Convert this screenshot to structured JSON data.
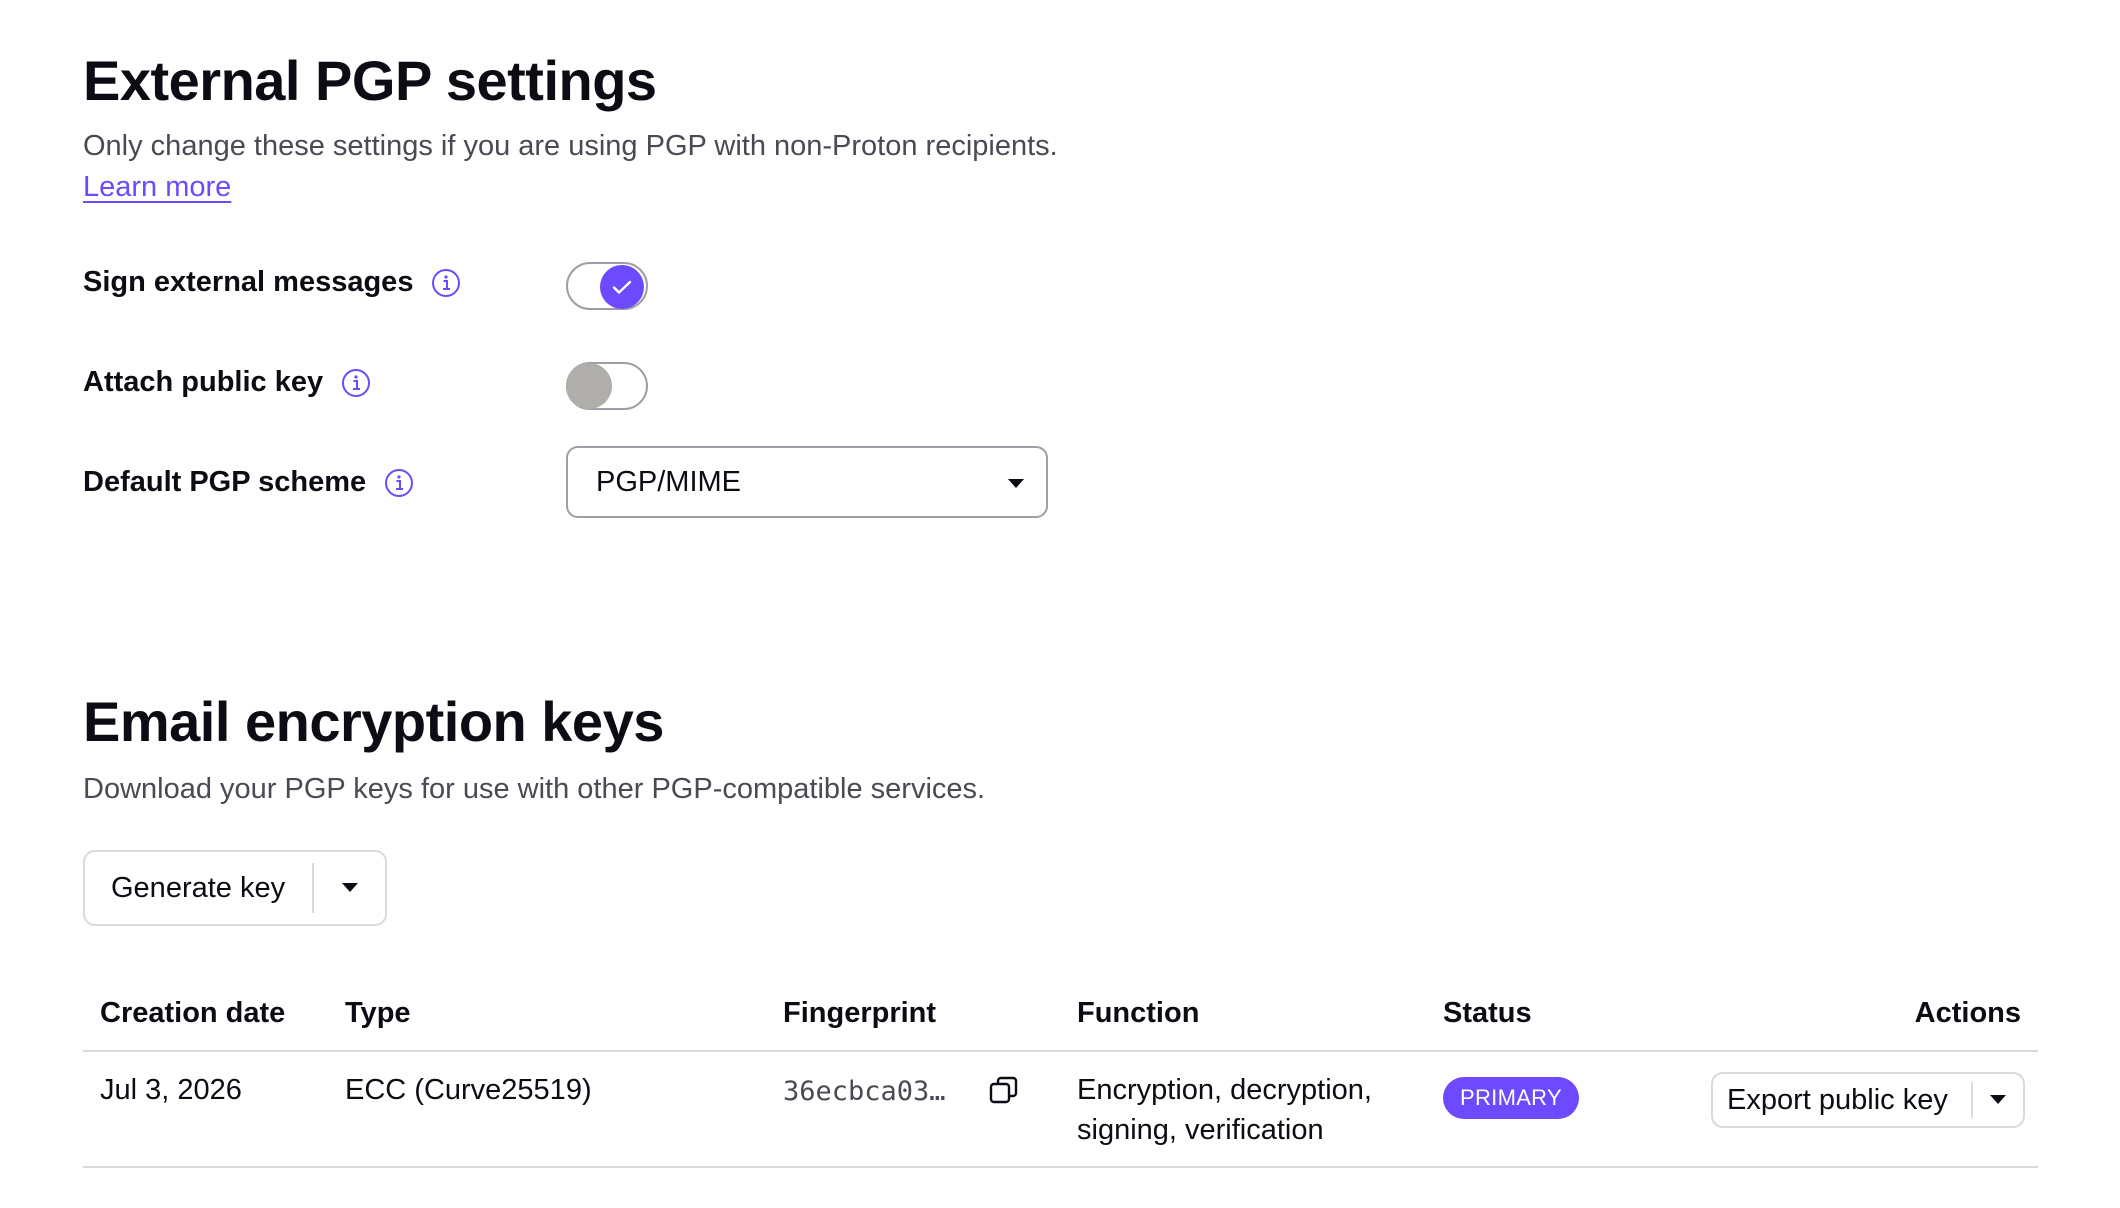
{
  "pgp": {
    "title": "External PGP settings",
    "description": "Only change these settings if you are using PGP with non-Proton recipients.",
    "learn_more": "Learn more",
    "sign_label": "Sign external messages",
    "sign_enabled": true,
    "attach_label": "Attach public key",
    "attach_enabled": false,
    "scheme_label": "Default PGP scheme",
    "scheme_value": "PGP/MIME"
  },
  "keys": {
    "title": "Email encryption keys",
    "description": "Download your PGP keys for use with other PGP-compatible services.",
    "generate_label": "Generate key",
    "columns": {
      "creation_date": "Creation date",
      "type": "Type",
      "fingerprint": "Fingerprint",
      "function": "Function",
      "status": "Status",
      "actions": "Actions"
    },
    "rows": [
      {
        "creation_date": "Jul 3, 2026",
        "type": "ECC (Curve25519)",
        "fingerprint": "36ecbca03…",
        "function_line1": "Encryption, decryption,",
        "function_line2": "signing, verification",
        "status": "PRIMARY",
        "action": "Export public key"
      }
    ]
  },
  "colors": {
    "accent": "#6d4aff",
    "toggle_off_knob": "#b0aeab",
    "border": "#d9d9df"
  }
}
